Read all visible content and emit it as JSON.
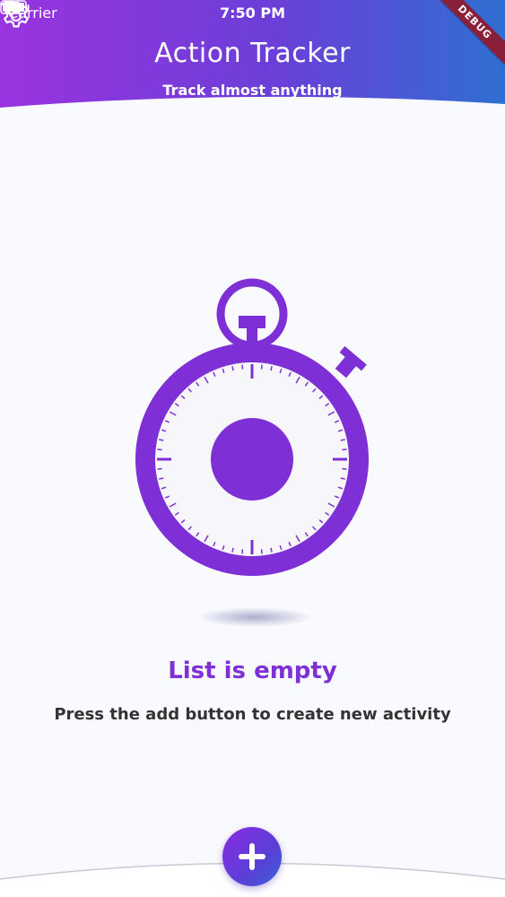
{
  "status_bar": {
    "carrier": "Carrier",
    "time": "7:50 PM"
  },
  "header": {
    "title": "Action Tracker",
    "subtitle": "Track almost anything",
    "settings_icon": "gear-icon",
    "debug_label": "DEBUG",
    "gradient": [
      "#9a33e0",
      "#6a3fd8",
      "#2f6fd2"
    ]
  },
  "empty_state": {
    "illustration_icon": "stopwatch-icon",
    "title": "List is empty",
    "message": "Press the add button to create new activity"
  },
  "fab": {
    "icon": "plus-icon"
  },
  "colors": {
    "accent": "#7e30d6",
    "background": "#f9fafd"
  }
}
